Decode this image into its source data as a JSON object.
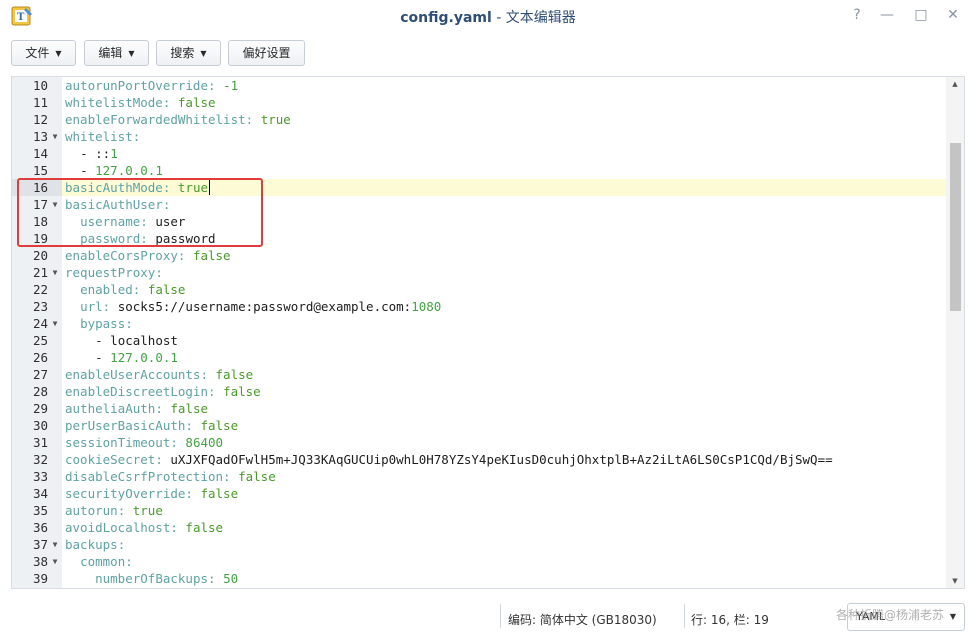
{
  "window": {
    "title_file": "config.yaml",
    "title_sep": " - ",
    "title_app": "文本编辑器",
    "help": "?",
    "minimize": "—",
    "maximize": "□",
    "close": "✕"
  },
  "toolbar": {
    "file": "文件",
    "edit": "编辑",
    "search": "搜索",
    "prefs": "偏好设置"
  },
  "editor": {
    "active_line": 16,
    "lines": [
      {
        "n": "10",
        "fold": false,
        "indent": "",
        "key": "autorunPortOverride",
        "value": "-1",
        "vclass": "n"
      },
      {
        "n": "11",
        "fold": false,
        "indent": "",
        "key": "whitelistMode",
        "value": "false",
        "vclass": "b"
      },
      {
        "n": "12",
        "fold": false,
        "indent": "",
        "key": "enableForwardedWhitelist",
        "value": "true",
        "vclass": "b"
      },
      {
        "n": "13",
        "fold": true,
        "indent": "",
        "key": "whitelist",
        "value": "",
        "vclass": "s"
      },
      {
        "n": "14",
        "fold": false,
        "indent": "  ",
        "item": "::",
        "value": "1",
        "vclass": "n"
      },
      {
        "n": "15",
        "fold": false,
        "indent": "  ",
        "item": "",
        "value": "127.0.0.1",
        "vclass": "n"
      },
      {
        "n": "16",
        "fold": false,
        "indent": "",
        "key": "basicAuthMode",
        "value": "true",
        "vclass": "b"
      },
      {
        "n": "17",
        "fold": true,
        "indent": "",
        "key": "basicAuthUser",
        "value": "",
        "vclass": "s"
      },
      {
        "n": "18",
        "fold": false,
        "indent": "  ",
        "key": "username",
        "value": "user",
        "vclass": "s"
      },
      {
        "n": "19",
        "fold": false,
        "indent": "  ",
        "key": "password",
        "value": "password",
        "vclass": "s"
      },
      {
        "n": "20",
        "fold": false,
        "indent": "",
        "key": "enableCorsProxy",
        "value": "false",
        "vclass": "b"
      },
      {
        "n": "21",
        "fold": true,
        "indent": "",
        "key": "requestProxy",
        "value": "",
        "vclass": "s"
      },
      {
        "n": "22",
        "fold": false,
        "indent": "  ",
        "key": "enabled",
        "value": "false",
        "vclass": "b"
      },
      {
        "n": "23",
        "fold": false,
        "indent": "  ",
        "key": "url",
        "value": "socks5://username:password@example.com:",
        "value2": "1080",
        "vclass": "s"
      },
      {
        "n": "24",
        "fold": true,
        "indent": "  ",
        "key": "bypass",
        "value": "",
        "vclass": "s"
      },
      {
        "n": "25",
        "fold": false,
        "indent": "    ",
        "item": "",
        "value": "localhost",
        "vclass": "s"
      },
      {
        "n": "26",
        "fold": false,
        "indent": "    ",
        "item": "",
        "value": "127.0.0.1",
        "vclass": "n"
      },
      {
        "n": "27",
        "fold": false,
        "indent": "",
        "key": "enableUserAccounts",
        "value": "false",
        "vclass": "b"
      },
      {
        "n": "28",
        "fold": false,
        "indent": "",
        "key": "enableDiscreetLogin",
        "value": "false",
        "vclass": "b"
      },
      {
        "n": "29",
        "fold": false,
        "indent": "",
        "key": "autheliaAuth",
        "value": "false",
        "vclass": "b"
      },
      {
        "n": "30",
        "fold": false,
        "indent": "",
        "key": "perUserBasicAuth",
        "value": "false",
        "vclass": "b"
      },
      {
        "n": "31",
        "fold": false,
        "indent": "",
        "key": "sessionTimeout",
        "value": "86400",
        "vclass": "n"
      },
      {
        "n": "32",
        "fold": false,
        "indent": "",
        "key": "cookieSecret",
        "value": "uXJXFQadOFwlH5m+JQ33KAqGUCUip0whL0H78YZsY4peKIusD0cuhjOhxtplB+Az2iLtA6LS0CsP1CQd/BjSwQ==",
        "vclass": "s"
      },
      {
        "n": "33",
        "fold": false,
        "indent": "",
        "key": "disableCsrfProtection",
        "value": "false",
        "vclass": "b"
      },
      {
        "n": "34",
        "fold": false,
        "indent": "",
        "key": "securityOverride",
        "value": "false",
        "vclass": "b"
      },
      {
        "n": "35",
        "fold": false,
        "indent": "",
        "key": "autorun",
        "value": "true",
        "vclass": "b"
      },
      {
        "n": "36",
        "fold": false,
        "indent": "",
        "key": "avoidLocalhost",
        "value": "false",
        "vclass": "b"
      },
      {
        "n": "37",
        "fold": true,
        "indent": "",
        "key": "backups",
        "value": "",
        "vclass": "s"
      },
      {
        "n": "38",
        "fold": true,
        "indent": "  ",
        "key": "common",
        "value": "",
        "vclass": "s"
      },
      {
        "n": "39",
        "fold": false,
        "indent": "    ",
        "key": "numberOfBackups",
        "value": "50",
        "vclass": "n"
      }
    ]
  },
  "status": {
    "encoding": "编码: 简体中文 (GB18030)",
    "position": "行: 16, 栏: 19",
    "language": "YAML"
  },
  "watermark": "各种折腾@杨浦老苏",
  "colors": {
    "key": "#5fa2a4",
    "bool": "#4a9a2a",
    "number": "#43a345",
    "highlight_box": "#e23b3b",
    "active_line": "#fcfbd5"
  }
}
